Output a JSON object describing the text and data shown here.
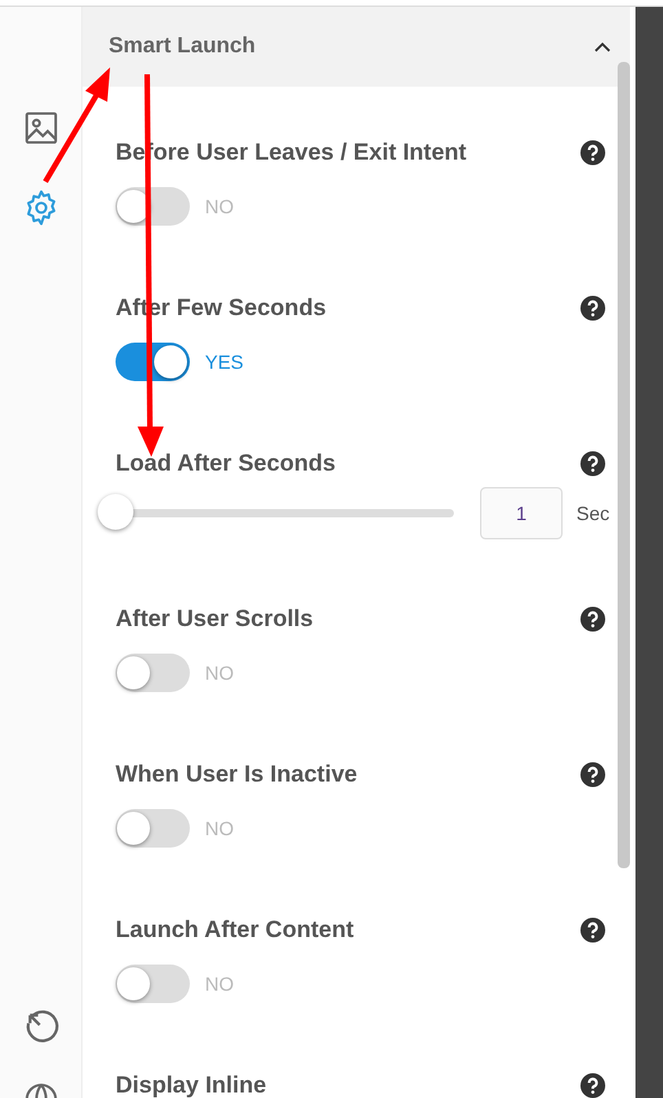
{
  "sidebar": {
    "items": [
      {
        "selected": false
      },
      {
        "selected": true
      },
      {
        "selected": false
      },
      {
        "selected": false
      }
    ]
  },
  "section": {
    "title": "Smart Launch",
    "expanded": true
  },
  "settings": [
    {
      "kind": "toggle",
      "label": "Before User Leaves / Exit Intent",
      "on": false,
      "state_text": "NO"
    },
    {
      "kind": "toggle",
      "label": "After Few Seconds",
      "on": true,
      "state_text": "YES"
    },
    {
      "kind": "slider",
      "label": "Load After Seconds",
      "level": 0,
      "value": "1",
      "unit": "Sec"
    },
    {
      "kind": "toggle",
      "label": "After User Scrolls",
      "on": false,
      "state_text": "NO"
    },
    {
      "kind": "toggle",
      "label": "When User Is Inactive",
      "on": false,
      "state_text": "NO"
    },
    {
      "kind": "toggle",
      "label": "Launch After Content",
      "on": false,
      "state_text": "NO"
    },
    {
      "kind": "heading",
      "label": "Display Inline"
    }
  ]
}
